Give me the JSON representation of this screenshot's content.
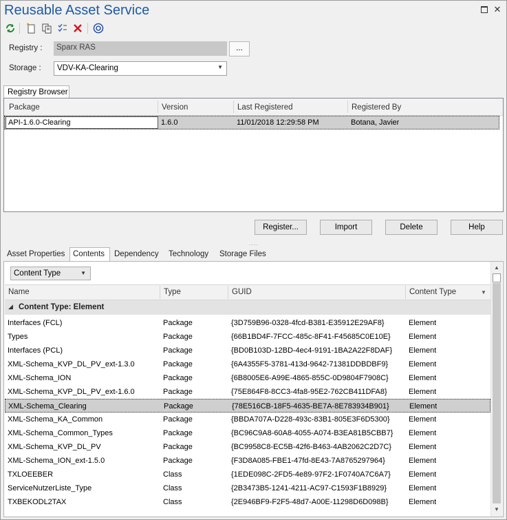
{
  "window": {
    "title": "Reusable Asset Service"
  },
  "registry": {
    "label": "Registry :",
    "value": "Sparx RAS",
    "browse_label": "..."
  },
  "storage": {
    "label": "Storage :",
    "value": "VDV-KA-Clearing"
  },
  "registry_tab": "Registry Browser",
  "packages": {
    "columns": [
      "Package",
      "Version",
      "Last Registered",
      "Registered By"
    ],
    "rows": [
      {
        "package": "API-1.6.0-Clearing",
        "version": "1.6.0",
        "last_registered": "11/01/2018 12:29:58 PM",
        "registered_by": "Botana, Javier"
      }
    ]
  },
  "actions": {
    "register": "Register...",
    "import": "Import",
    "delete": "Delete",
    "help": "Help"
  },
  "detail_tabs": [
    "Asset Properties",
    "Contents",
    "Dependency",
    "Technology",
    "Storage Files"
  ],
  "group_by": "Content Type",
  "contents": {
    "columns": [
      "Name",
      "Type",
      "GUID",
      "Content Type"
    ],
    "group_label": "Content Type: Element",
    "rows": [
      {
        "name": "Interfaces (FCL)",
        "type": "Package",
        "guid": "{3D759B96-0328-4fcd-B381-E35912E29AF8}",
        "ctype": "Element"
      },
      {
        "name": "Types",
        "type": "Package",
        "guid": "{66B1BD4F-7FCC-485c-8F41-F45685C0E10E}",
        "ctype": "Element"
      },
      {
        "name": "Interfaces (PCL)",
        "type": "Package",
        "guid": "{BD0B103D-12BD-4ec4-9191-1BA2A22F8DAF}",
        "ctype": "Element"
      },
      {
        "name": "XML-Schema_KVP_DL_PV_ext-1.3.0",
        "type": "Package",
        "guid": "{6A4355F5-3781-413d-9642-71381DDBDBF9}",
        "ctype": "Element"
      },
      {
        "name": "XML-Schema_ION",
        "type": "Package",
        "guid": "{6B8005E6-A99E-4865-855C-0D9804F7908C}",
        "ctype": "Element"
      },
      {
        "name": "XML-Schema_KVP_DL_PV_ext-1.6.0",
        "type": "Package",
        "guid": "{75E864F8-8CC3-4fa8-95E2-762CB411DFA8}",
        "ctype": "Element"
      },
      {
        "name": "XML-Schema_Clearing",
        "type": "Package",
        "guid": "{78E516CB-18F5-4635-BE7A-8E783934B901}",
        "ctype": "Element",
        "selected": true
      },
      {
        "name": "XML-Schema_KA_Common",
        "type": "Package",
        "guid": "{BBDA707A-D228-493c-83B1-805E3F6D5300}",
        "ctype": "Element"
      },
      {
        "name": "XML-Schema_Common_Types",
        "type": "Package",
        "guid": "{BC96C9A8-60A8-4055-A074-B3EA81B5CBB7}",
        "ctype": "Element"
      },
      {
        "name": "XML-Schema_KVP_DL_PV",
        "type": "Package",
        "guid": "{BC9958C8-EC5B-42f6-B463-4AB2062C2D7C}",
        "ctype": "Element"
      },
      {
        "name": "XML-Schema_ION_ext-1.5.0",
        "type": "Package",
        "guid": "{F3D8A085-FBE1-47fd-8E43-7A8765297964}",
        "ctype": "Element"
      },
      {
        "name": "TXLOEEBER",
        "type": "Class",
        "guid": "{1EDE098C-2FD5-4e89-97F2-1F0740A7C6A7}",
        "ctype": "Element"
      },
      {
        "name": "ServiceNutzerListe_Type",
        "type": "Class",
        "guid": "{2B3473B5-1241-4211-AC97-C1593F1B8929}",
        "ctype": "Element"
      },
      {
        "name": "TXBEKODL2TAX",
        "type": "Class",
        "guid": "{2E946BF9-F2F5-48d7-A00E-11298D6D098B}",
        "ctype": "Element"
      }
    ]
  },
  "colors": {
    "title": "#1e5aa8",
    "selection": "#cfcfcf",
    "selection_border": "#333333"
  },
  "icons": [
    "refresh-icon",
    "new-icon",
    "copy-icon",
    "checklist-icon",
    "delete-icon",
    "help-icon"
  ]
}
